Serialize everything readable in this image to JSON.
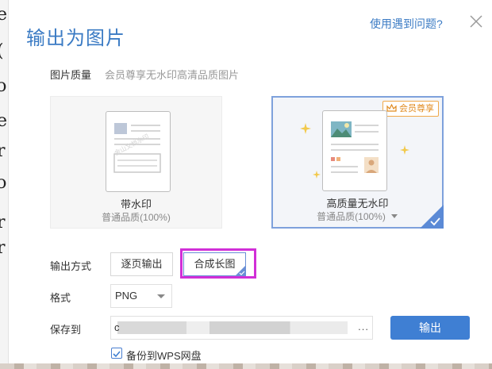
{
  "dialog": {
    "title": "输出为图片",
    "help_link": "使用遇到问题?",
    "close_icon": "close-icon"
  },
  "quality": {
    "label": "图片质量",
    "hint": "会员尊享无水印高清品质图片",
    "options": [
      {
        "title": "带水印",
        "subtitle": "普通品质(100%)",
        "watermark_text": "金山文档水印",
        "selected": false
      },
      {
        "title": "高质量无水印",
        "subtitle": "普通品质(100%)",
        "badge": "会员尊享",
        "selected": true
      }
    ]
  },
  "output_mode": {
    "label": "输出方式",
    "options": [
      "逐页输出",
      "合成长图"
    ],
    "selected": "合成长图"
  },
  "format": {
    "label": "格式",
    "value": "PNG"
  },
  "save_to": {
    "label": "保存到",
    "value": "c",
    "browse": "..."
  },
  "export_button": "输出",
  "backup": {
    "label": "备份到WPS网盘",
    "checked": true
  },
  "colors": {
    "accent": "#3b7bc4",
    "primary_button": "#3f7fd3",
    "vip": "#e08a1e",
    "highlight": "#d12fd7"
  },
  "background_app": {
    "visible_glyphs": [
      "e",
      "(",
      "ɔ",
      "e",
      "r",
      "ɔ",
      "r",
      "r"
    ]
  }
}
